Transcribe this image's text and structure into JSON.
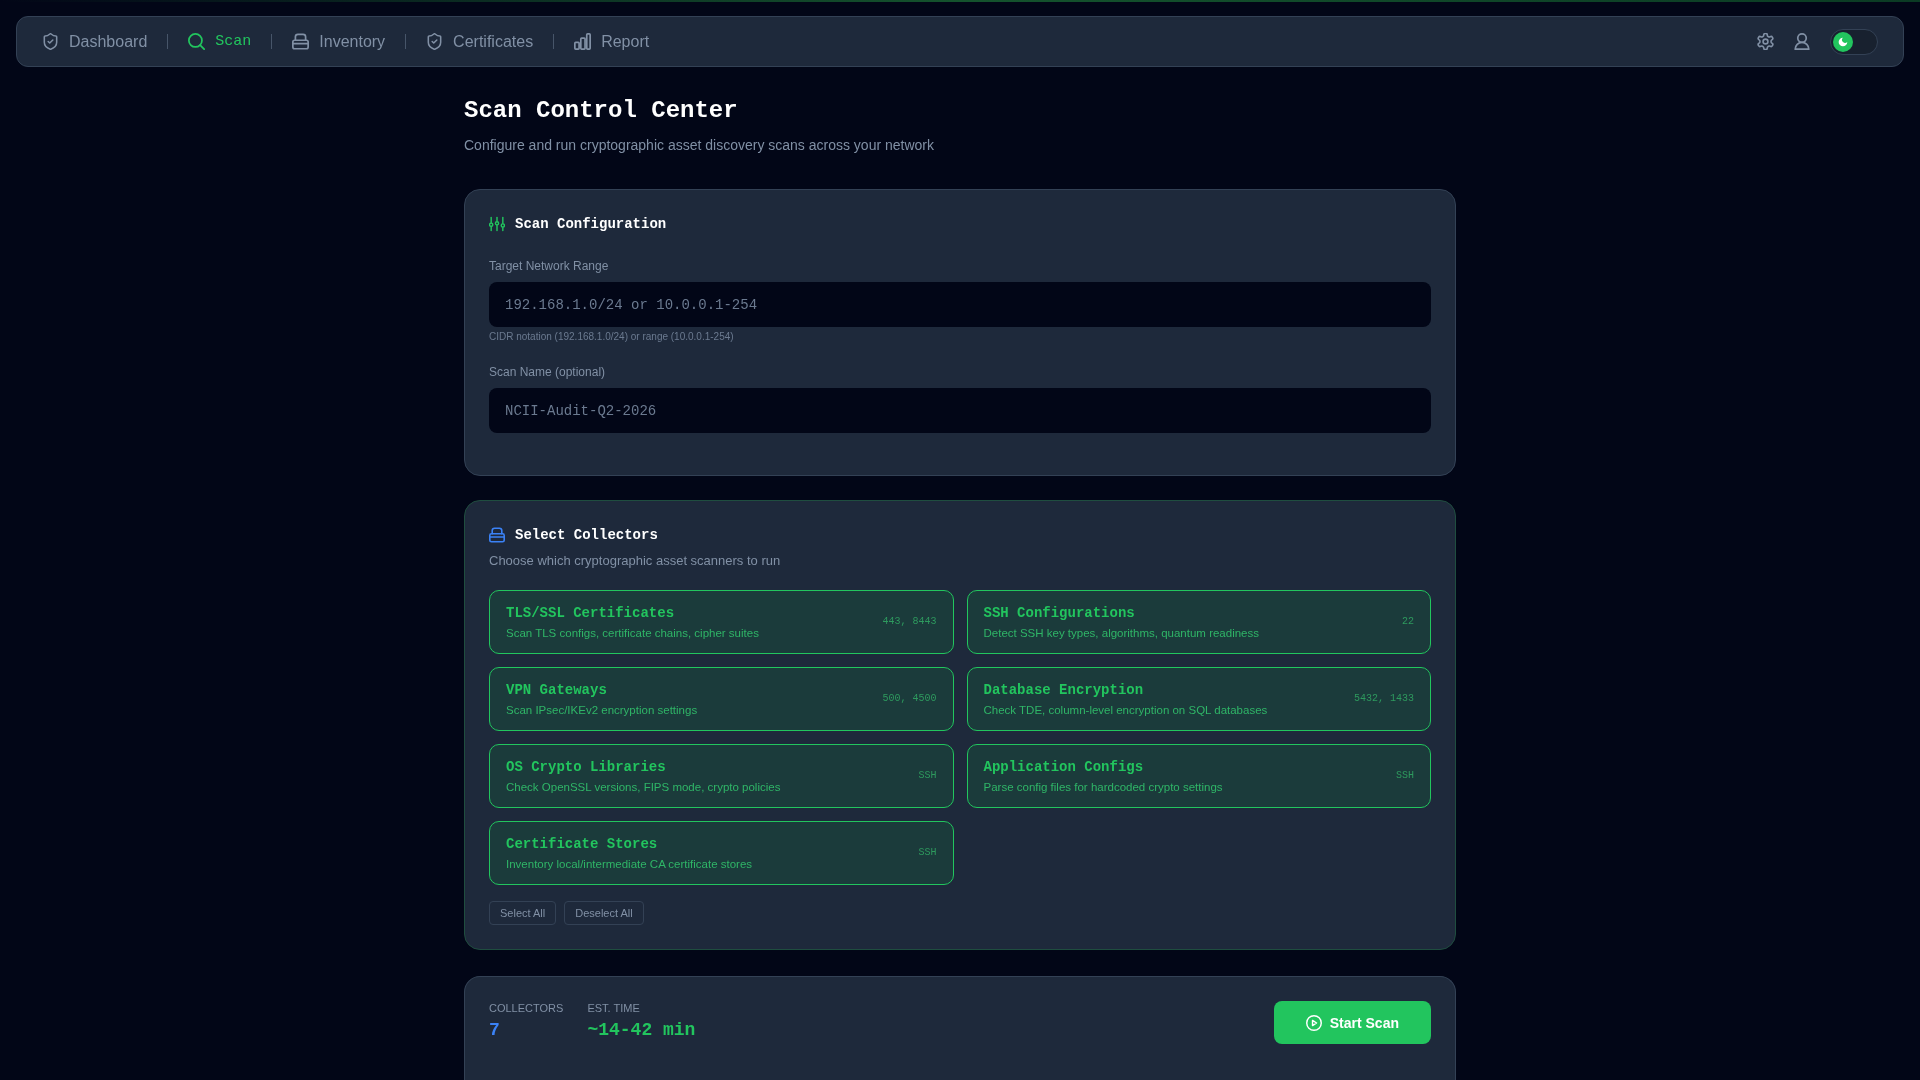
{
  "nav": {
    "tabs": [
      {
        "label": "Dashboard",
        "selected": false
      },
      {
        "label": "Scan",
        "selected": true
      },
      {
        "label": "Inventory",
        "selected": false
      },
      {
        "label": "Certificates",
        "selected": false
      },
      {
        "label": "Report",
        "selected": false
      }
    ]
  },
  "theme_toggle": {
    "on": true
  },
  "page": {
    "title": "Scan Control Center",
    "subtitle": "Configure and run cryptographic asset discovery scans across your network"
  },
  "scan_configuration": {
    "title": "Scan Configuration",
    "fields": [
      {
        "label": "Target Network Range",
        "placeholder": "192.168.1.0/24 or 10.0.0.1-254",
        "hint": "CIDR notation (192.168.1.0/24) or range (10.0.0.1-254)"
      },
      {
        "label": "Scan Name (optional)",
        "placeholder": "NCII-Audit-Q2-2026"
      }
    ]
  },
  "collectors": {
    "title": "Select Collectors",
    "subtitle": "Choose which cryptographic asset scanners to run",
    "items": [
      {
        "name": "TLS/SSL Certificates",
        "description": "Scan TLS configs, certificate chains, cipher suites",
        "tag": "443, 8443",
        "selected": true
      },
      {
        "name": "SSH Configurations",
        "description": "Detect SSH key types, algorithms, quantum readiness",
        "tag": "22",
        "selected": true
      },
      {
        "name": "VPN Gateways",
        "description": "Scan IPsec/IKEv2 encryption settings",
        "tag": "500, 4500",
        "selected": true
      },
      {
        "name": "Database Encryption",
        "description": "Check TDE, column-level encryption on SQL databases",
        "tag": "5432, 1433",
        "selected": true
      },
      {
        "name": "OS Crypto Libraries",
        "description": "Check OpenSSL versions, FIPS mode, crypto policies",
        "tag": "SSH",
        "selected": true
      },
      {
        "name": "Application Configs",
        "description": "Parse config files for hardcoded crypto settings",
        "tag": "SSH",
        "selected": true
      },
      {
        "name": "Certificate Stores",
        "description": "Inventory local/intermediate CA certificate stores",
        "tag": "SSH",
        "selected": true
      }
    ],
    "buttons": [
      "Select All",
      "Deselect All"
    ]
  },
  "summary": {
    "stats": [
      {
        "label": "COLLECTORS",
        "value": "7",
        "color": "#3b82f6"
      },
      {
        "label": "EST. TIME",
        "value": "~14-42 min",
        "color": "#22c55e"
      }
    ],
    "action": "Start Scan"
  }
}
